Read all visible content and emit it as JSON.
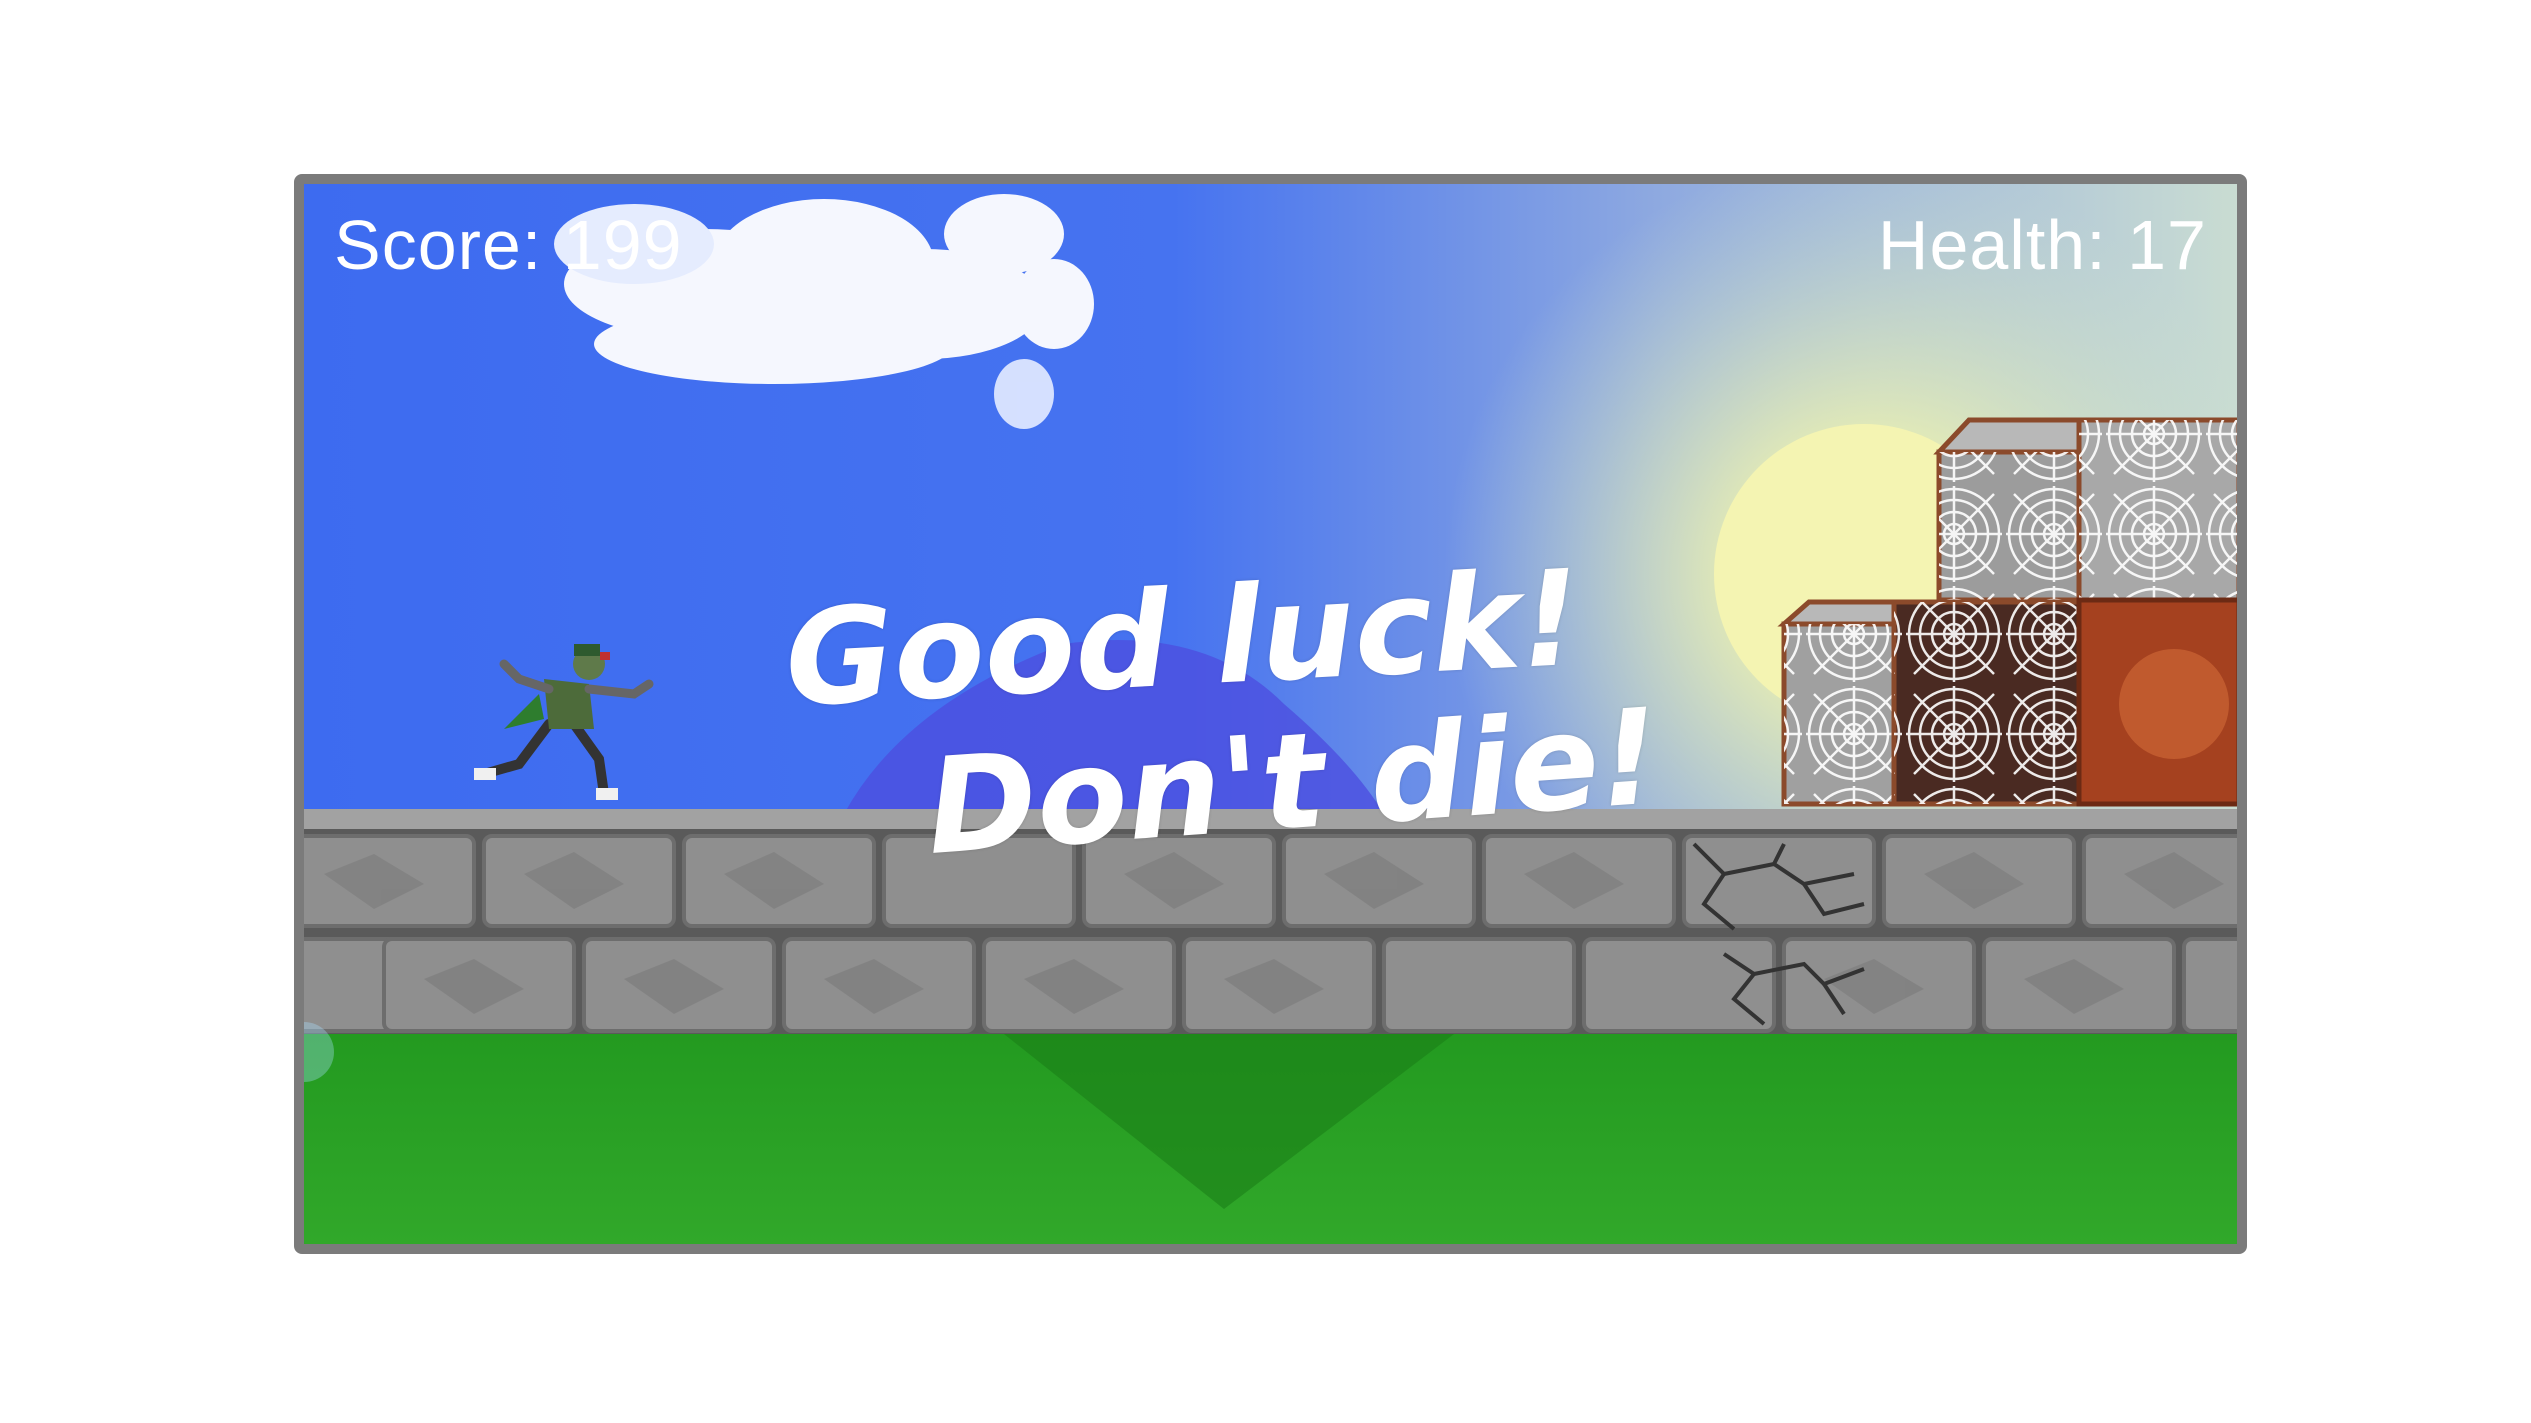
{
  "hud": {
    "score_label": "Score: 199",
    "health_label": "Health: 17"
  },
  "message": {
    "line1": "Good luck!",
    "line2": "Don't die!"
  },
  "colors": {
    "sky": "#3f6ff2",
    "sun_glow": "#f6f6b8",
    "stone": "#8c8c8c",
    "grass": "#2a9b22",
    "frame": "#7b7b7b",
    "crate": "#8b4a2b"
  },
  "icons": {
    "player": "ninja-runner-sprite",
    "cloud": "cloud-shape",
    "sun": "sun-disc",
    "crate": "web-crate"
  }
}
